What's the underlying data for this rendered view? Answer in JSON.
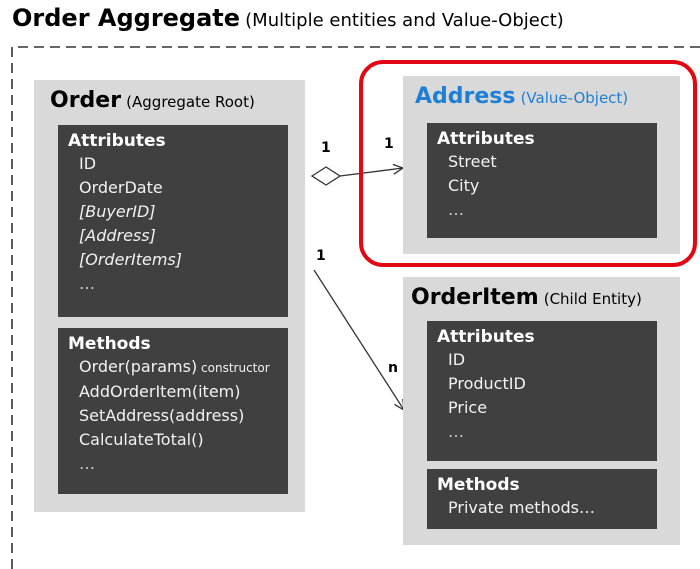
{
  "aggregate": {
    "title": "Order Aggregate",
    "subtitle": "(Multiple entities and Value-Object)"
  },
  "order": {
    "title": "Order",
    "subtitle": "(Aggregate Root)",
    "attributes_header": "Attributes",
    "attributes": [
      "ID",
      "OrderDate",
      "[BuyerID]",
      "[Address]",
      "[OrderItems]",
      "…"
    ],
    "methods_header": "Methods",
    "methods": [
      {
        "name": "Order(params)",
        "note": " constructor"
      },
      {
        "name": "AddOrderItem(item)",
        "note": ""
      },
      {
        "name": "SetAddress(address)",
        "note": ""
      },
      {
        "name": "CalculateTotal()",
        "note": ""
      },
      {
        "name": "…",
        "note": ""
      }
    ]
  },
  "address": {
    "title": "Address",
    "subtitle": "(Value-Object)",
    "attributes_header": "Attributes",
    "attributes": [
      "Street",
      "City",
      "…"
    ]
  },
  "orderitem": {
    "title": "OrderItem",
    "subtitle": "(Child Entity)",
    "attributes_header": "Attributes",
    "attributes": [
      "ID",
      "ProductID",
      "Price",
      "…"
    ],
    "methods_header": "Methods",
    "methods": [
      "Private methods…"
    ]
  },
  "multiplicities": {
    "address_source": "1",
    "address_target": "1",
    "orderitem_source": "1",
    "orderitem_target": "n"
  },
  "colors": {
    "entity_bg": "#d9d9d9",
    "panel_bg": "#404040",
    "value_object_accent": "#1f7fd4",
    "highlight_border": "#e30613"
  }
}
